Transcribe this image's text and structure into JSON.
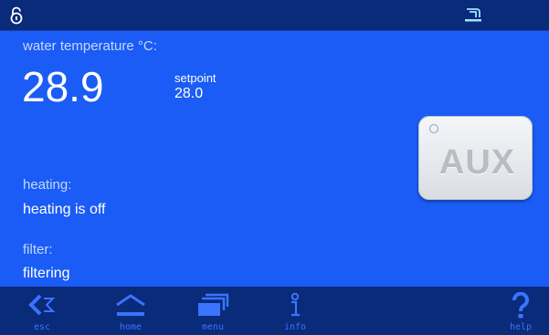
{
  "topbar": {
    "lock_icon": "lock-open-icon",
    "pump_icon": "pump-status-icon"
  },
  "main": {
    "water_temp_label": "water temperature °C:",
    "water_temp_value": "28.9",
    "setpoint_label": "setpoint",
    "setpoint_value": "28.0",
    "heating_label": "heating:",
    "heating_status": "heating is off",
    "filter_label": "filter:",
    "filter_status": "filtering",
    "aux_button_label": "AUX"
  },
  "nav": {
    "esc_label": "esc",
    "home_label": "home",
    "menu_label": "menu",
    "info_label": "info",
    "help_label": "help"
  },
  "colors": {
    "background": "#1a5cf5",
    "bars": "#0a2a7a",
    "nav_icons": "#3a74ff",
    "text_light": "#c8d8ff"
  }
}
